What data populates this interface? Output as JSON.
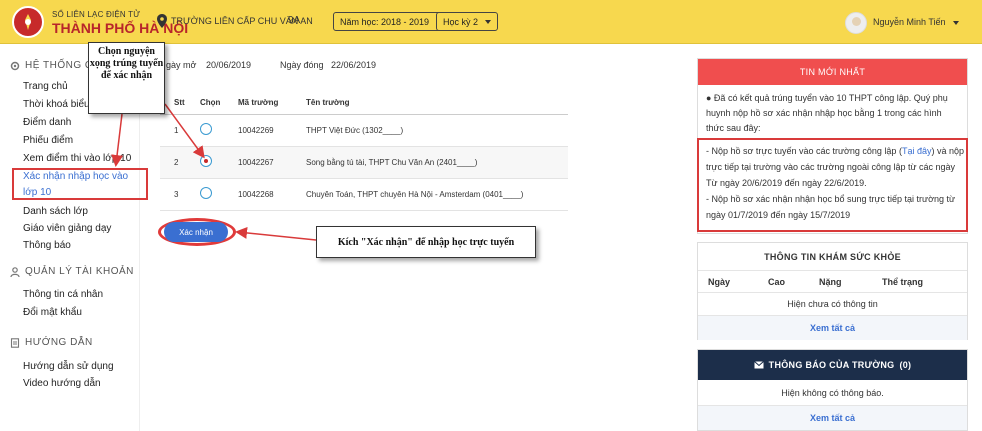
{
  "header": {
    "logo_line1": "SỔ LIÊN LẠC ĐIỆN TỬ",
    "logo_line2": "THÀNH PHỐ HÀ NỘI",
    "school_name": "TRƯỜNG LIÊN CẤP CHU VĂN AN",
    "class_name": "9A",
    "school_year": "Năm học: 2018 - 2019",
    "semester": "Học kỳ 2",
    "user_name": "Nguyễn Minh Tiến",
    "accent": "#f7d84e"
  },
  "sidebar": {
    "section1": "HỆ THỐNG QU",
    "items1": [
      "Trang chủ",
      "Thời khoá biểu",
      "Điểm danh",
      "Phiếu điểm",
      "Xem điểm thi vào lớp 10",
      "Xác nhận nhập học vào",
      "lớp 10",
      "Danh sách lớp",
      "Giáo viên giảng dạy",
      "Thông báo"
    ],
    "section2": "QUẢN LÝ TÀI KHOẢN",
    "items2": [
      "Thông tin cá nhân",
      "Đổi mật khẩu"
    ],
    "section3": "HƯỚNG DẪN",
    "items3": [
      "Hướng dẫn sử dụng",
      "Video hướng dẫn"
    ]
  },
  "main": {
    "open_label": "gày mở",
    "open_date": "20/06/2019",
    "close_label": "Ngày đóng",
    "close_date": "22/06/2019",
    "columns": [
      "Stt",
      "Chọn",
      "Mã trường",
      "Tên trường"
    ],
    "rows": [
      {
        "stt": "1",
        "code": "10042269",
        "name": "THPT Việt Đức (1302____)",
        "checked": false
      },
      {
        "stt": "2",
        "code": "10042267",
        "name": "Song bằng tú tài, THPT Chu Văn An (2401____)",
        "checked": true
      },
      {
        "stt": "3",
        "code": "10042268",
        "name": "Chuyên Toán, THPT chuyên Hà Nội - Amsterdam (0401____)",
        "checked": false
      }
    ],
    "confirm_label": "Xác nhận"
  },
  "annotations": {
    "callout1": "Chọn nguyện xọng trúng tuyển để xác nhận",
    "callout2": "Kích \"Xác nhận\" để nhập học trực tuyến"
  },
  "news": {
    "title": "TIN MỚI NHẤT",
    "intro": "● Đã có kết quả trúng tuyển vào 10 THPT công lập. Quý phụ huynh nộp hồ sơ xác nhận nhập học bằng 1 trong các hình thức sau đây:",
    "p1_a": "-     Nộp hồ sơ trực tuyến vào các trường công lập (",
    "p1_link": "Tại đây",
    "p1_b": ") và nộp trực tiếp tại trường vào các trường ngoài công lập từ các ngày Từ ngày 20/6/2019 đến ngày 22/6/2019.",
    "p2": "-     Nộp hồ sơ xác nhận nhận học bổ sung trực tiếp tại trường từ ngày 01/7/2019 đến ngày 15/7/2019",
    "header_color": "#f04e4e"
  },
  "health": {
    "title": "THÔNG TIN KHÁM SỨC KHỎE",
    "columns": [
      "Ngày",
      "Cao",
      "Nặng",
      "Thể trạng"
    ],
    "empty": "Hiện chưa có thông tin",
    "view_all": "Xem tất cả"
  },
  "notice": {
    "title": "THÔNG BÁO CỦA TRƯỜNG",
    "count": "(0)",
    "empty": "Hiện không có thông báo.",
    "view_all": "Xem tất cả",
    "header_color": "#1c2e4a"
  }
}
